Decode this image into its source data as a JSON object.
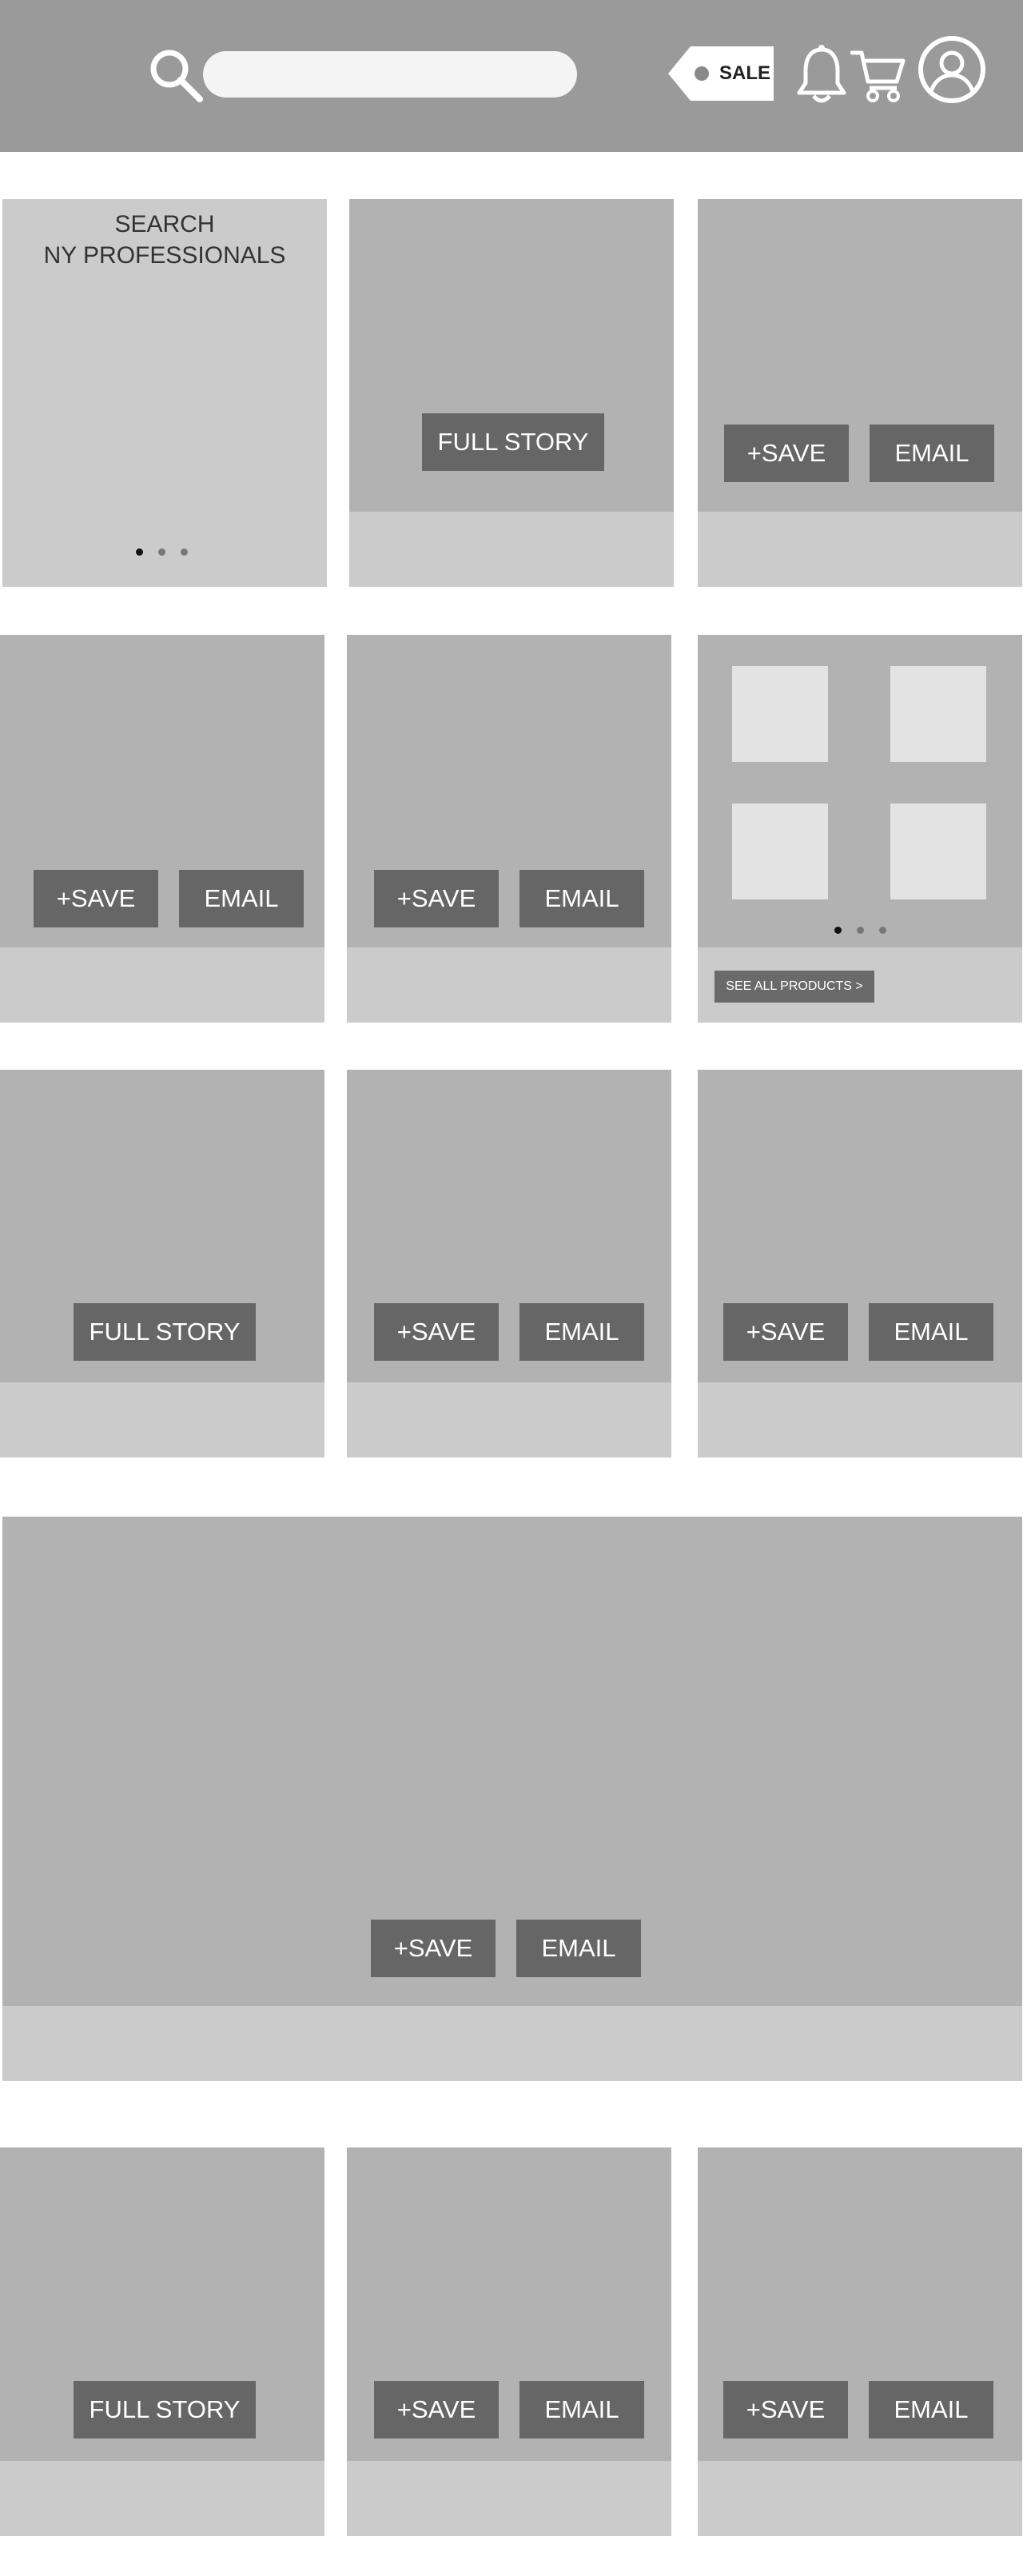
{
  "header": {
    "search": {
      "placeholder": ""
    },
    "sale_label": "SALE",
    "icons": [
      "search-icon",
      "sale-tag-icon",
      "bell-icon",
      "cart-icon",
      "account-icon"
    ]
  },
  "promo_card": {
    "line1": "SEARCH",
    "line2": "NY PROFESSIONALS"
  },
  "buttons": {
    "save": "+SAVE",
    "email": "EMAIL",
    "full_story": "FULL STORY",
    "see_all": "SEE ALL PRODUCTS >"
  },
  "colors": {
    "header_bg": "#9a9a9a",
    "card_bg": "#b2b2b2",
    "card_footer_bg": "#cbcbcb",
    "button_bg": "#666666",
    "thumb_bg": "#e3e3e3"
  }
}
